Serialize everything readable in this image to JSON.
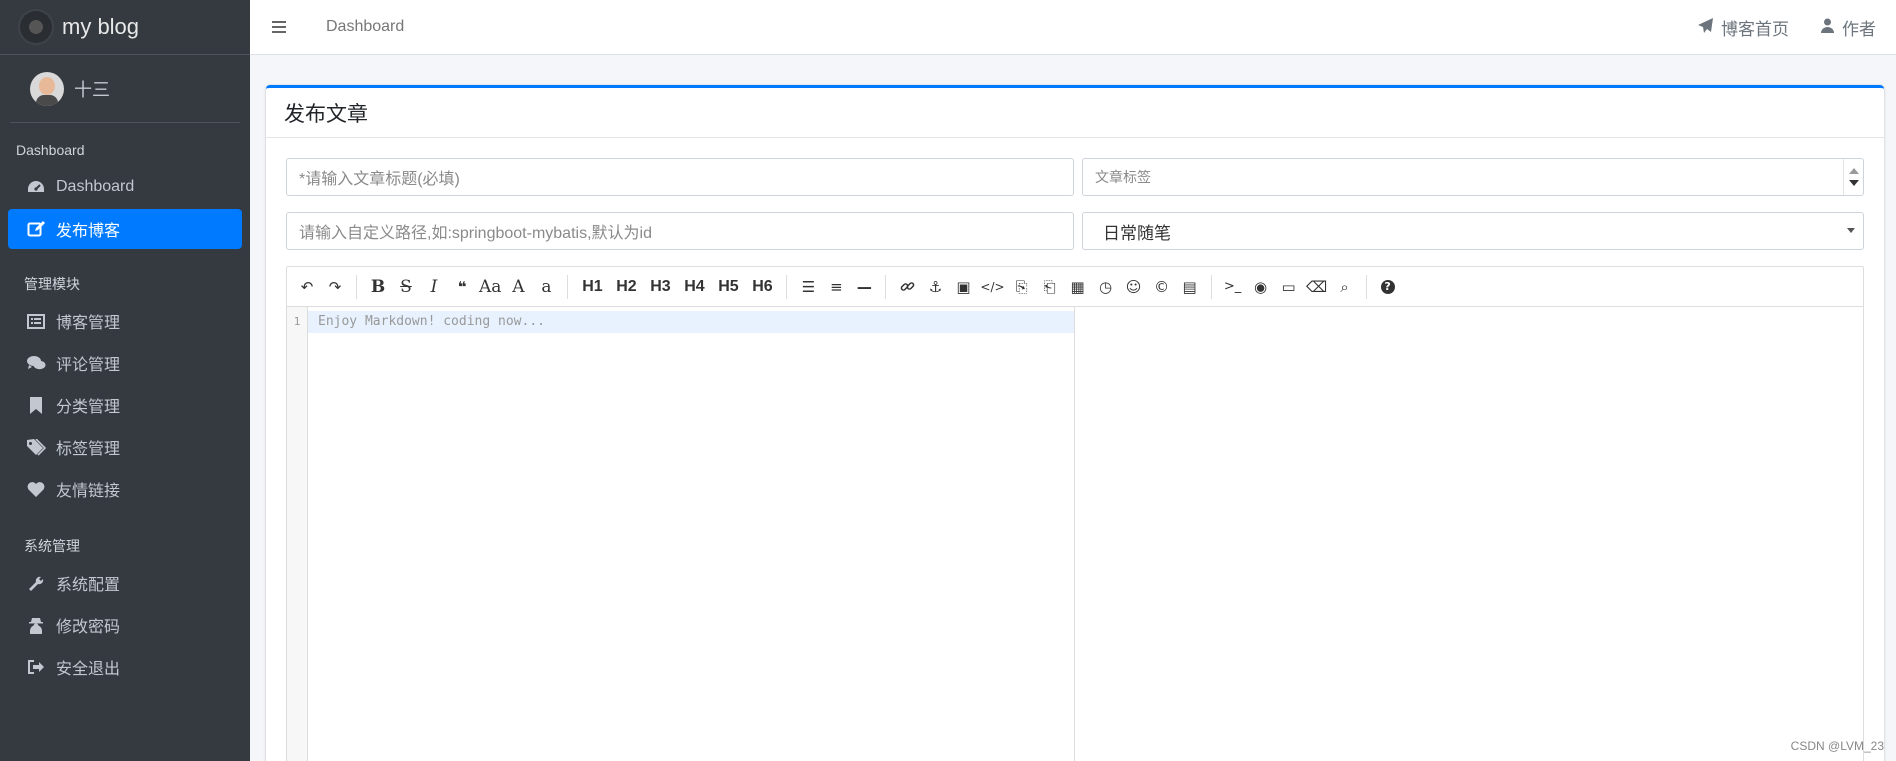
{
  "brand": {
    "name": "my blog"
  },
  "user": {
    "name": "十三"
  },
  "sidebar": {
    "section_dashboard": "Dashboard",
    "section_modules": "管理模块",
    "section_system": "系统管理",
    "items": [
      {
        "label": "Dashboard",
        "icon": "dashboard-icon"
      },
      {
        "label": "发布博客",
        "icon": "edit-icon"
      },
      {
        "label": "博客管理",
        "icon": "list-icon"
      },
      {
        "label": "评论管理",
        "icon": "comments-icon"
      },
      {
        "label": "分类管理",
        "icon": "bookmark-icon"
      },
      {
        "label": "标签管理",
        "icon": "tags-icon"
      },
      {
        "label": "友情链接",
        "icon": "heart-icon"
      },
      {
        "label": "系统配置",
        "icon": "wrench-icon"
      },
      {
        "label": "修改密码",
        "icon": "user-secret-icon"
      },
      {
        "label": "安全退出",
        "icon": "sign-out-icon"
      }
    ]
  },
  "topbar": {
    "breadcrumb": "Dashboard",
    "home_link": "博客首页",
    "author_link": "作者"
  },
  "card": {
    "title": "发布文章",
    "title_input_placeholder": "*请输入文章标题(必填)",
    "tags_input_placeholder": "文章标签",
    "path_input_placeholder": "请输入自定义路径,如:springboot-mybatis,默认为id",
    "category_selected": "日常随笔"
  },
  "editor": {
    "line_number": "1",
    "placeholder": "Enjoy Markdown! coding now...",
    "toolbar": {
      "undo": "↶",
      "redo": "↷",
      "bold": "B",
      "strike": "S",
      "italic": "I",
      "quote": "❝",
      "uppercase": "Aa",
      "ucwords": "A",
      "lowercase": "a",
      "h1": "H1",
      "h2": "H2",
      "h3": "H3",
      "h4": "H4",
      "h5": "H5",
      "h6": "H6",
      "list_ul": "☰",
      "list_ol": "≡",
      "hr": "—",
      "link": "🔗",
      "anchor": "⚓",
      "image": "▣",
      "code": "</>",
      "preformatted": "⎘",
      "code_block": "⎗",
      "table": "▦",
      "datetime": "◷",
      "emoji": "☺",
      "html_entities": "©",
      "pagebreak": "▤",
      "goto_line": ">_",
      "watch": "◉",
      "fullscreen": "▭",
      "clear": "⌫",
      "search": "⌕",
      "help": "?"
    }
  },
  "watermark": "CSDN @LVM_23"
}
